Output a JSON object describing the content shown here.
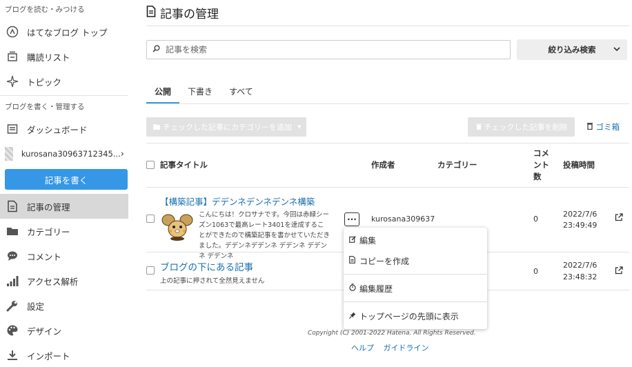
{
  "sidebar": {
    "section1": "ブログを読む・みつける",
    "read_items": [
      {
        "label": "はてなブログ トップ",
        "icon": "hatena-circle-icon"
      },
      {
        "label": "購読リスト",
        "icon": "subscription-list-icon"
      },
      {
        "label": "トピック",
        "icon": "topic-sparkle-icon"
      }
    ],
    "section2": "ブログを書く・管理する",
    "dashboard": "ダッシュボード",
    "blog_name": "kurosana30963712345...",
    "write_button": "記事を書く",
    "manage_items": [
      {
        "label": "記事の管理",
        "icon": "document-icon",
        "active": true
      },
      {
        "label": "カテゴリー",
        "icon": "folder-icon"
      },
      {
        "label": "コメント",
        "icon": "comment-icon"
      },
      {
        "label": "アクセス解析",
        "icon": "bar-chart-icon"
      },
      {
        "label": "設定",
        "icon": "wrench-icon"
      },
      {
        "label": "デザイン",
        "icon": "palette-icon"
      },
      {
        "label": "インポート",
        "icon": "import-icon"
      }
    ]
  },
  "header": {
    "title": "記事の管理"
  },
  "search": {
    "placeholder": "記事を検索",
    "filter_label": "絞り込み検索"
  },
  "tabs": [
    "公開",
    "下書き",
    "すべて"
  ],
  "actions": {
    "add_category": "チェックした記事にカテゴリーを追加",
    "delete_checked": "チェックした記事を削除",
    "trash_link": "ゴミ箱"
  },
  "table": {
    "headers": {
      "title": "記事タイトル",
      "author": "作成者",
      "category": "カテゴリー",
      "comments": "コメント数",
      "posted": "投稿時間"
    },
    "rows": [
      {
        "title": "【構築記事】デデンネデンネデンネ構築",
        "excerpt": "こんにちは！クロサナです。今回は赤緑シーズン1063で最高レート3401を達成することができたので構築記事を書かせていただきました。デデンネデデンネ デデンネ デデンネ デデンネ",
        "author": "kurosana309637",
        "comments": "0",
        "date": "2022/7/6",
        "time": "23:49:49"
      },
      {
        "title": "ブログの下にある記事",
        "excerpt": "上の記事に押されて全然見えません",
        "author": "",
        "comments": "0",
        "date": "2022/7/6",
        "time": "23:48:32"
      }
    ]
  },
  "menu": {
    "edit": "編集",
    "copy": "コピーを作成",
    "history": "編集履歴",
    "pin": "トップページの先頭に表示"
  },
  "footer": {
    "copyright": "Copyright (C) 2001-2022 Hatena. All Rights Reserved.",
    "help": "ヘルプ",
    "guideline": "ガイドライン"
  },
  "colors": {
    "accent": "#3597e6",
    "link": "#1a6fb0",
    "active_bg": "#d8d8d8"
  }
}
